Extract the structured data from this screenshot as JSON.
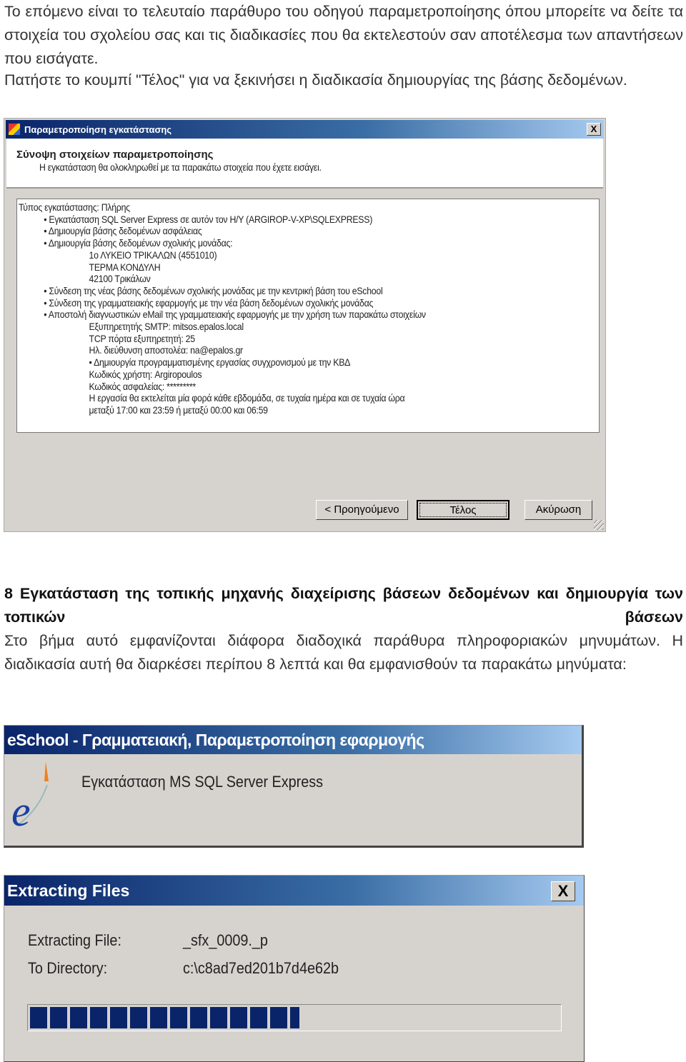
{
  "intro": {
    "line1": "Το επόμενο είναι το τελευταίο παράθυρο του οδηγού παραμετροποίησης όπου μπορείτε να δείτε τα στοιχεία του σχολείου σας και τις διαδικασίες που θα εκτελεστούν σαν αποτέλεσμα των απαντήσεων που εισάγατε.",
    "line2": "Πατήστε το κουμπί \"Τέλος\" για να ξεκινήσει η διαδικασία δημιουργίας της βάσης δεδομένων."
  },
  "wizard": {
    "title": "Παραμετροποίηση εγκατάστασης",
    "heading": "Σύνοψη στοιχείων παραμετροποίησης",
    "subheading": "Η εγκατάσταση θα ολοκληρωθεί με τα παρακάτω στοιχεία που έχετε εισάγει.",
    "summary": [
      {
        "indent": 0,
        "text": "Τύπος εγκατάστασης: Πλήρης"
      },
      {
        "indent": 1,
        "text": "• Εγκατάσταση SQL Server Express σε αυτόν τον Η/Υ (ARGIROP-V-XP\\SQLEXPRESS)"
      },
      {
        "indent": 1,
        "text": "• Δημιουργία βάσης δεδομένων ασφάλειας"
      },
      {
        "indent": 1,
        "text": "• Δημιουργία βάσης δεδομένων σχολικής μονάδας:"
      },
      {
        "indent": 2,
        "text": "1ο ΛΥΚΕΙΟ ΤΡΙΚΑΛΩΝ (4551010)"
      },
      {
        "indent": 2,
        "text": "ΤΕΡΜΑ ΚΟΝΔΥΛΗ"
      },
      {
        "indent": 2,
        "text": "42100 Τρικάλων"
      },
      {
        "indent": 1,
        "text": "• Σύνδεση της νέας βάσης δεδομένων σχολικής μονάδας με την κεντρική βάση του eSchool"
      },
      {
        "indent": 1,
        "text": "• Σύνδεση της γραμματειακής εφαρμογής με την νέα βάση δεδομένων σχολικής μονάδας"
      },
      {
        "indent": 1,
        "text": "• Αποστολή διαγνωστικών eMail της γραμματειακής εφαρμογής με την χρήση των παρακάτω στοιχείων"
      },
      {
        "indent": 2,
        "text": "Εξυπηρετητής SMTP: mitsos.epalos.local"
      },
      {
        "indent": 2,
        "text": "TCP πόρτα εξυπηρετητή: 25"
      },
      {
        "indent": 2,
        "text": "Ηλ. διεύθυνση αποστολέα: na@epalos.gr"
      },
      {
        "indent": 2,
        "text": "• Δημιουργία προγραμματισμένης εργασίας συγχρονισμού με την ΚΒΔ"
      },
      {
        "indent": 2,
        "text": "Κωδικός χρήστη: Argiropoulos"
      },
      {
        "indent": 2,
        "text": "Κωδικός ασφαλείας: *********"
      },
      {
        "indent": 2,
        "text": "Η εργασία θα εκτελείται μία φορά κάθε εβδομάδα, σε τυχαία ημέρα και σε τυχαία ώρα"
      },
      {
        "indent": 2,
        "text": "μεταξύ 17:00 και 23:59 ή μεταξύ 00:00 και 06:59"
      }
    ],
    "buttons": {
      "back": "< Προηγούμενο",
      "finish": "Τέλος",
      "cancel": "Ακύρωση"
    },
    "close": "X"
  },
  "section": {
    "heading": "8 Εγκατάσταση της τοπικής μηχανής διαχείρισης βάσεων δεδομένων και δημιουργία των τοπικών βάσεων",
    "body": "Στο βήμα αυτό εμφανίζονται διάφορα διαδοχικά παράθυρα πληροφοριακών μηνυμάτων. Η διαδικασία αυτή θα διαρκέσει περίπου 8 λεπτά και θα εμφανισθούν τα παρακάτω μηνύματα:"
  },
  "splash": {
    "title": "eSchool - Γραμματειακή, Παραμετροποίηση εφαρμογής",
    "message": "Εγκατάσταση MS SQL Server Express",
    "logo_icon": "eschool-e-logo"
  },
  "extract": {
    "title": "Extracting Files",
    "close": "X",
    "file_label": "Extracting File:",
    "file_value": "_sfx_0009._p",
    "dir_label": "To Directory:",
    "dir_value": "c:\\c8ad7ed201b7d4e62b",
    "progress_percent": 51,
    "progress_color": "#0a246a"
  }
}
